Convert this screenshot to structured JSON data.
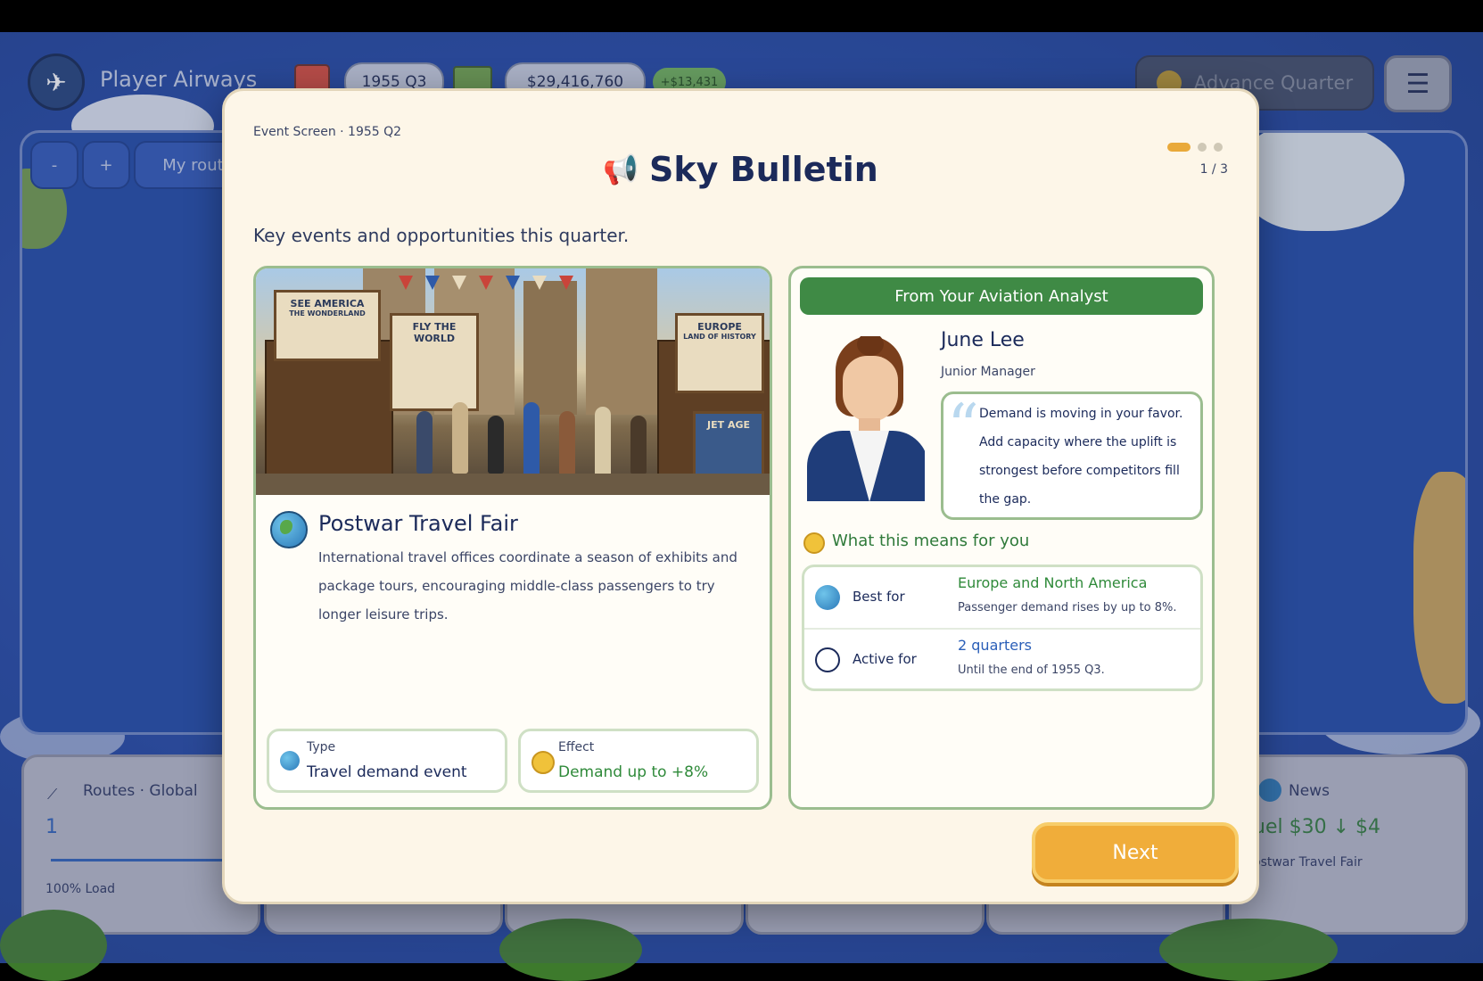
{
  "hud": {
    "airline_name": "Player Airways",
    "quarter": "1955 Q3",
    "cash": "$29,416,760",
    "cash_delta": "+$13,431",
    "advance_label": "Advance Quarter"
  },
  "map": {
    "zoom_out_label": "-",
    "zoom_in_label": "+",
    "my_routes_label": "My route"
  },
  "dock": {
    "routes_title": "Routes · Global",
    "routes_count": "1",
    "routes_load": "100% Load",
    "news_title": "News",
    "news_headline": "uel $30 ↓ $4",
    "news_sub": "ostwar Travel Fair"
  },
  "modal": {
    "breadcrumb": "Event Screen · 1955 Q2",
    "title": "Sky Bulletin",
    "pager": "1 / 3",
    "subtitle": "Key events and opportunities this quarter.",
    "next_label": "Next"
  },
  "event": {
    "name": "Postwar Travel Fair",
    "description": "International travel offices coordinate a season of exhibits and package tours, encouraging middle-class passengers to try longer leisure trips.",
    "poster_left": "SEE AMERICA",
    "poster_left_sub": "THE WONDERLAND",
    "poster_mid": "FLY THE WORLD",
    "poster_right": "EUROPE",
    "poster_right_sub": "LAND OF HISTORY",
    "poster_jet": "JET AGE",
    "type_key": "Type",
    "type_val": "Travel demand event",
    "effect_key": "Effect",
    "effect_val": "Demand up to +8%"
  },
  "analyst": {
    "header": "From Your Aviation Analyst",
    "name": "June Lee",
    "role": "Junior Manager",
    "quote": "Demand is moving in your favor. Add capacity where the uplift is strongest before competitors fill the gap.",
    "means_label": "What this means for you",
    "best_key": "Best for",
    "best_val": "Europe and North America",
    "best_note": "Passenger demand rises by up to 8%.",
    "active_key": "Active for",
    "active_val": "2 quarters",
    "active_note": "Until the end of 1955 Q3."
  },
  "colors": {
    "accent_green": "#3f8a45",
    "accent_orange": "#f0ad3a",
    "title_navy": "#1b2a5a",
    "link_blue": "#2b5fb8"
  }
}
